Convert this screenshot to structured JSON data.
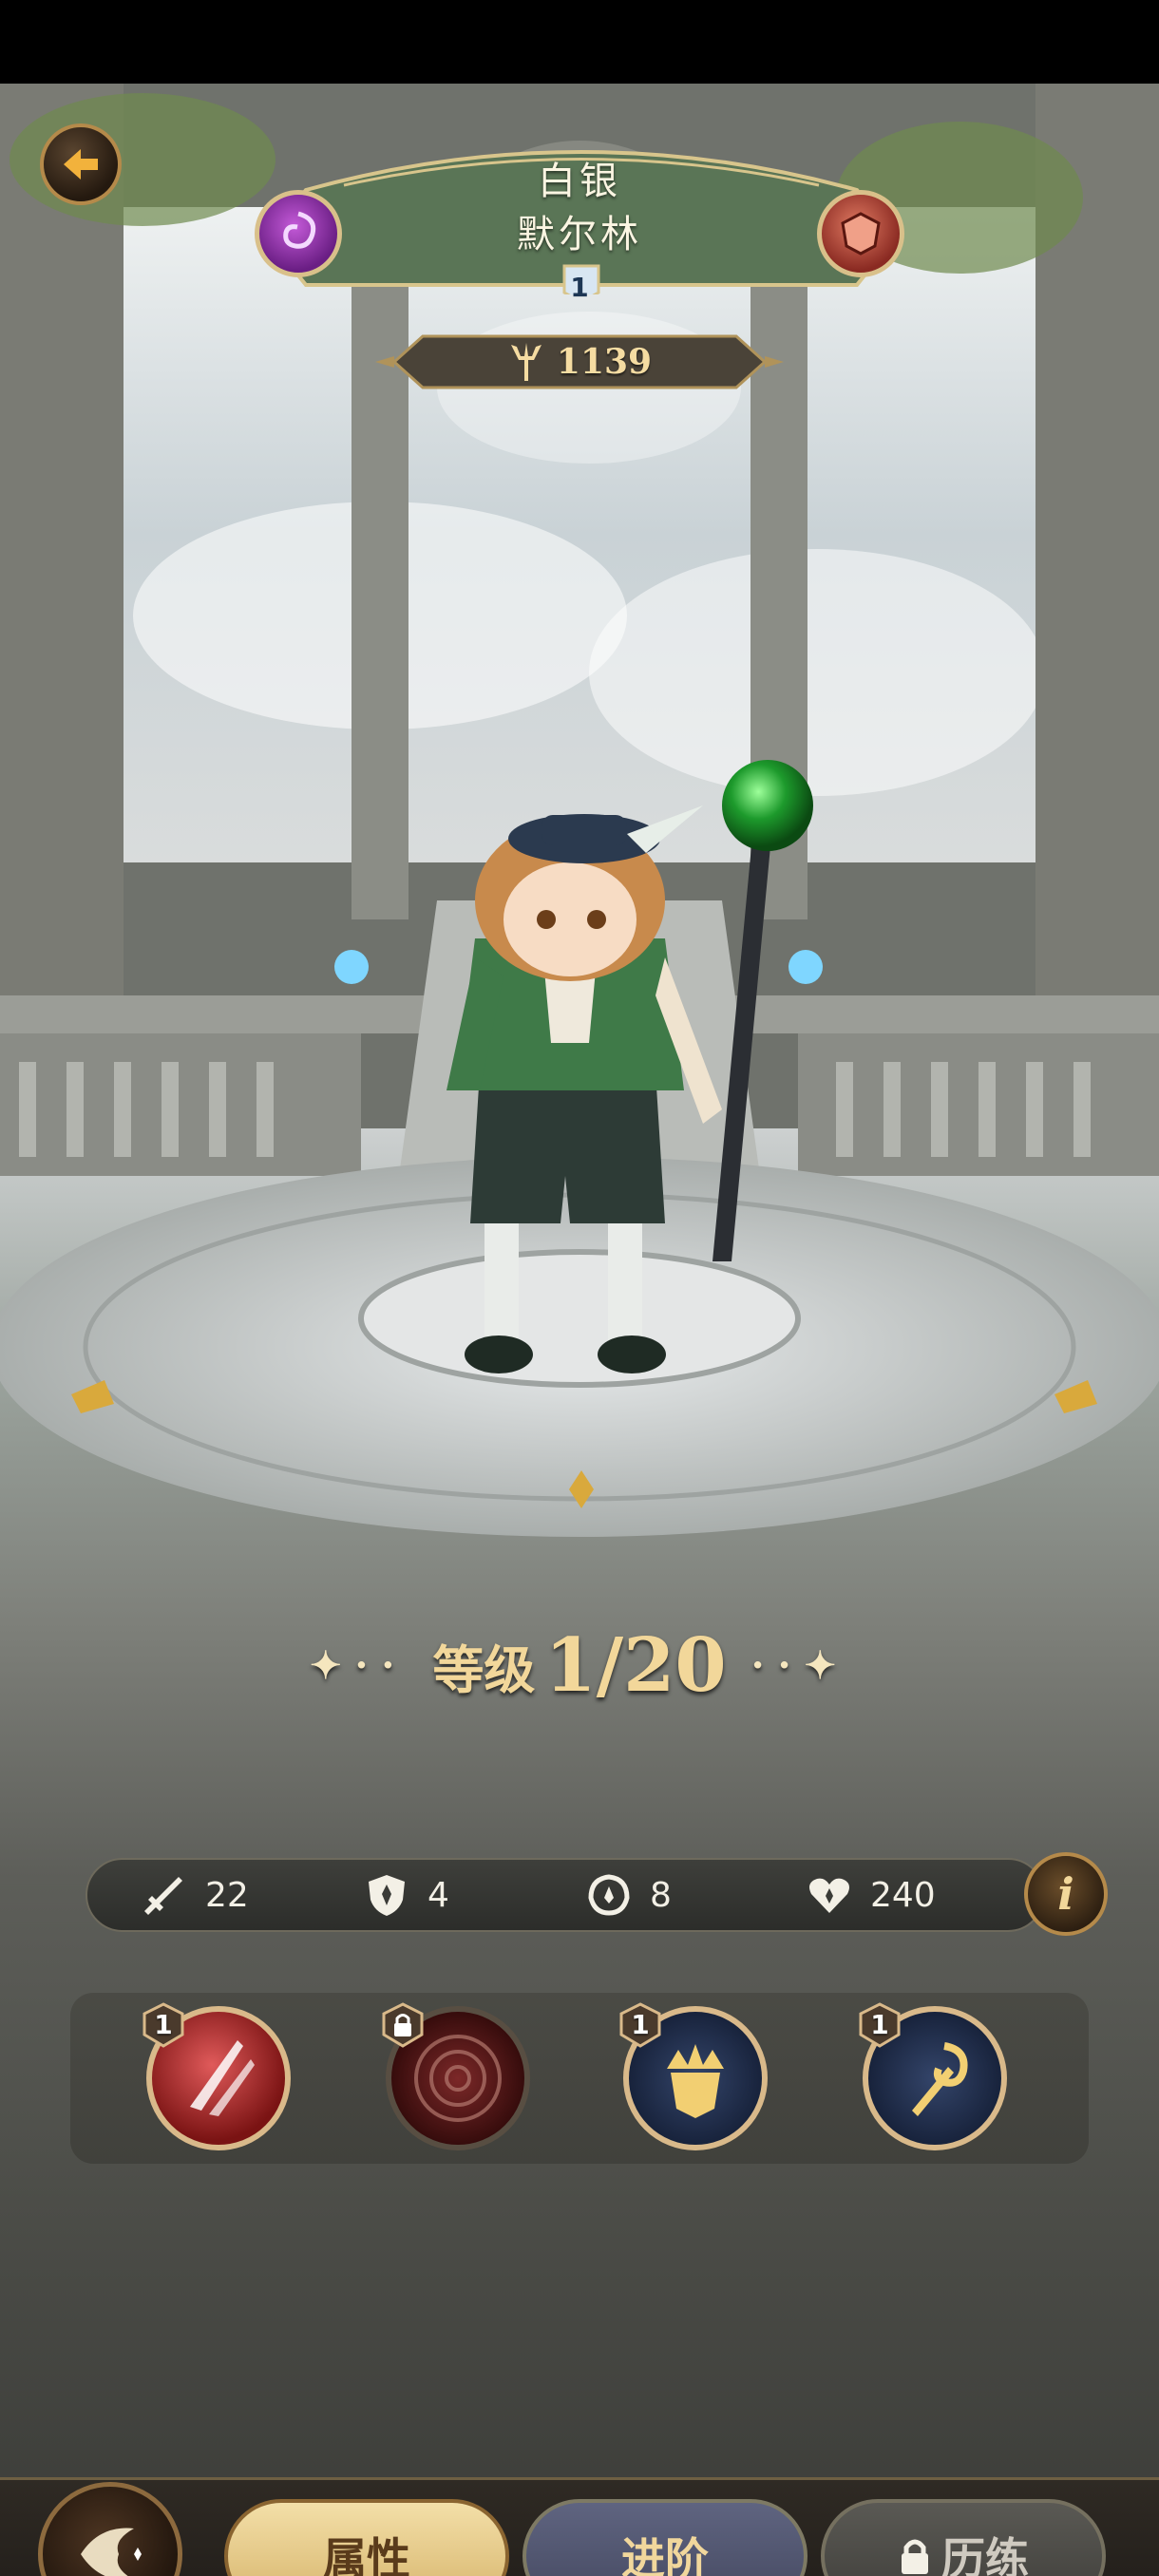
{
  "header": {
    "rank": "白银",
    "hero_name": "默尔林",
    "star": "1",
    "power": "1139"
  },
  "level": {
    "label": "等级",
    "value": "1/20"
  },
  "stats": [
    {
      "icon": "sword-icon",
      "value": "22"
    },
    {
      "icon": "shield-icon",
      "value": "4"
    },
    {
      "icon": "speed-icon",
      "value": "8"
    },
    {
      "icon": "heart-icon",
      "value": "240"
    }
  ],
  "skills": [
    {
      "icon": "claw-slash-skill-icon",
      "badge": "1"
    },
    {
      "icon": "locked-vortex-skill-icon",
      "badge": "lock"
    },
    {
      "icon": "crown-shield-skill-icon",
      "badge": "1"
    },
    {
      "icon": "staff-emblem-skill-icon",
      "badge": "1"
    }
  ],
  "tabs": {
    "attributes": "属性",
    "advance": "进阶",
    "training": "历练"
  },
  "colors": {
    "gold": "#f2d79a",
    "nameplate_green": "#5d7a5a",
    "faction_left": "#9b3bb5",
    "faction_right": "#b8483a"
  }
}
